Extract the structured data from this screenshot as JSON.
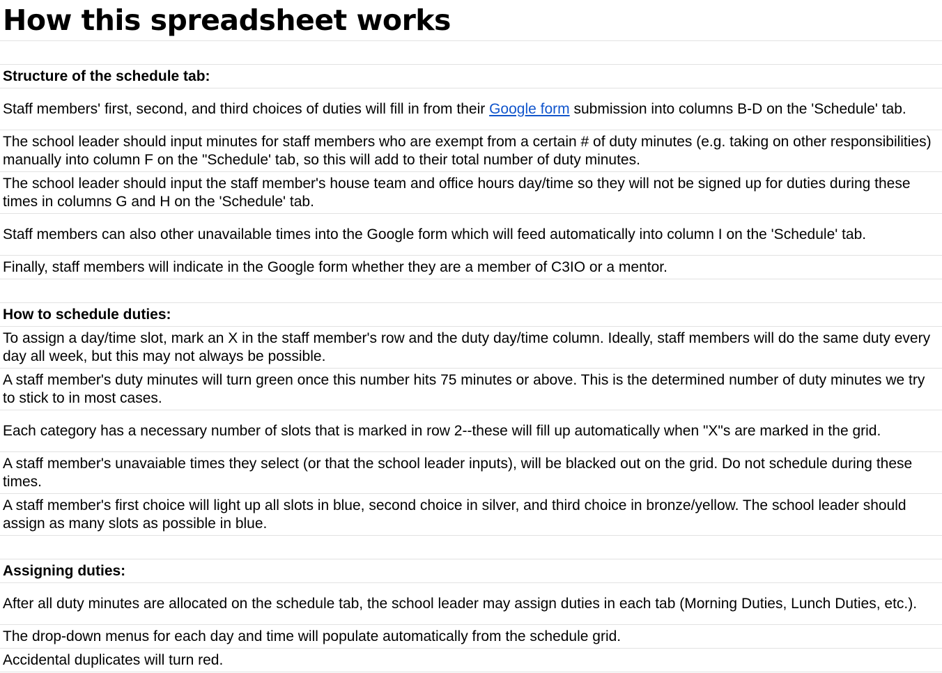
{
  "title": "How this spreadsheet works",
  "sections": [
    {
      "heading": "Structure of the schedule tab:",
      "rows": [
        {
          "before": "Staff members' first, second, and third choices of duties will fill in from their ",
          "link": "Google form",
          "after": " submission into columns B-D on the 'Schedule' tab."
        },
        {
          "text": "The school leader should input minutes for staff members who are exempt from a certain # of duty minutes (e.g. taking on other responsibilities) manually into column F on the \"Schedule' tab, so this will add to their total number of duty minutes."
        },
        {
          "text": "The school leader should input the staff member's house team and office hours day/time so they will not be signed up for duties during these times in columns G and H on the 'Schedule' tab."
        },
        {
          "text": "Staff members can also other unavailable times into the Google form which will feed automatically into column I on the 'Schedule' tab."
        },
        {
          "text": "Finally, staff members will indicate in the Google form whether they are a member of C3IO or a mentor."
        }
      ]
    },
    {
      "heading": "How to schedule duties:",
      "rows": [
        {
          "text": "To assign a day/time slot, mark an X in the staff member's row and the duty day/time column. Ideally, staff members will do the same duty every day all week, but this may not always be possible."
        },
        {
          "text": "A staff member's duty minutes will turn green once this number hits 75 minutes or above. This is the determined number of duty minutes we try to stick to in most cases."
        },
        {
          "text": "Each category has a necessary number of slots that is marked in row 2--these will fill up automatically when \"X\"s are marked in the grid."
        },
        {
          "text": "A staff member's unavaiable times they select (or that the school leader inputs), will be blacked out on the grid. Do not schedule during these times."
        },
        {
          "text": "A staff member's first choice will light up all slots in blue, second choice in silver, and third choice in bronze/yellow. The school leader should assign as many slots as possible in blue."
        }
      ]
    },
    {
      "heading": "Assigning duties:",
      "rows": [
        {
          "text": "After all duty minutes are allocated on the schedule tab, the school leader may assign duties in each tab (Morning Duties, Lunch Duties, etc.)."
        },
        {
          "text": "The drop-down menus for each day and time will populate automatically from the schedule grid."
        },
        {
          "text": "Accidental duplicates will turn red."
        }
      ]
    }
  ],
  "colors": {
    "link": "#1155cc",
    "gridline": "#e2e2e2"
  }
}
